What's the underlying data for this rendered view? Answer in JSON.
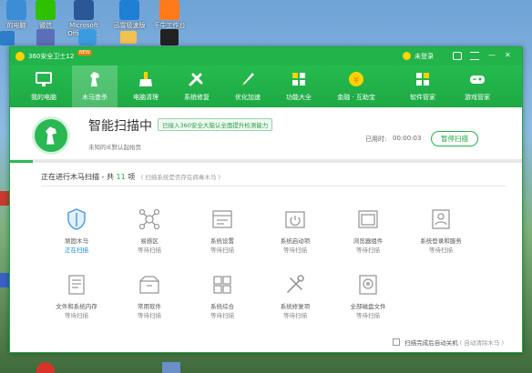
{
  "desktop": {
    "icons": [
      {
        "label": "的电脑"
      },
      {
        "label": "微信"
      },
      {
        "label": "Microsoft"
      },
      {
        "label": "Office W..."
      },
      {
        "label": "迅雷极速版"
      },
      {
        "label": "千牛工作台"
      }
    ]
  },
  "window": {
    "title": "360安全卫士12",
    "badge": "NEW",
    "login": "未登录",
    "controls": {
      "skin": "skin-icon",
      "menu": "menu-icon",
      "minimize": "—",
      "close": "✕"
    },
    "tools": [
      {
        "label": "我的电脑",
        "icon": "monitor-icon"
      },
      {
        "label": "木马查杀",
        "icon": "horse-icon"
      },
      {
        "label": "电脑清理",
        "icon": "broom-icon"
      },
      {
        "label": "系统修复",
        "icon": "wrench-icon"
      },
      {
        "label": "优化加速",
        "icon": "rocket-icon"
      },
      {
        "label": "功能大全",
        "icon": "grid-icon"
      },
      {
        "label": "金融 · 互助宝",
        "icon": "coin-icon"
      },
      {
        "label": "软件管家",
        "icon": "apps-icon"
      },
      {
        "label": "游戏管家",
        "icon": "gamepad-icon"
      }
    ],
    "hero": {
      "title": "智能扫描中",
      "notice": "已接入360安全大脑认全面提升检测能力",
      "subtitle": "未知的IE默认起始页",
      "elapsed_label": "已用时:",
      "elapsed_value": "00:00:03",
      "pause_button": "暂停扫描",
      "progress": 0.045
    },
    "scan": {
      "title_prefix": "正在进行木马扫描 - 共",
      "count": "11",
      "count_suffix": "项",
      "hint": "( 扫描系统是否存在病毒木马 )"
    },
    "items": [
      {
        "name": "顽固木马",
        "status": "正在扫描",
        "active": true,
        "icon": "shield-icon"
      },
      {
        "name": "易感区",
        "status": "等待扫描",
        "icon": "network-icon"
      },
      {
        "name": "系统设置",
        "status": "等待扫描",
        "icon": "settings-icon"
      },
      {
        "name": "系统启动项",
        "status": "等待扫描",
        "icon": "power-icon"
      },
      {
        "name": "浏览器组件",
        "status": "等待扫描",
        "icon": "browser-icon"
      },
      {
        "name": "系统登录和服务",
        "status": "等待扫描",
        "icon": "user-card-icon"
      },
      {
        "name": "文件和系统内存",
        "status": "等待扫描",
        "icon": "document-icon"
      },
      {
        "name": "常用软件",
        "status": "等待扫描",
        "icon": "box-icon"
      },
      {
        "name": "系统综合",
        "status": "等待扫描",
        "icon": "windows-icon"
      },
      {
        "name": "系统修复项",
        "status": "等待扫描",
        "icon": "tools-icon"
      },
      {
        "name": "全部磁盘文件",
        "status": "等待扫描",
        "icon": "disk-icon"
      }
    ],
    "footer": {
      "checkbox_label": "扫描完成后自动关机",
      "checkbox_note": "( 自动清除木马 )"
    }
  },
  "colors": {
    "primary": "#22b44a",
    "active_status": "#1a8de0"
  }
}
